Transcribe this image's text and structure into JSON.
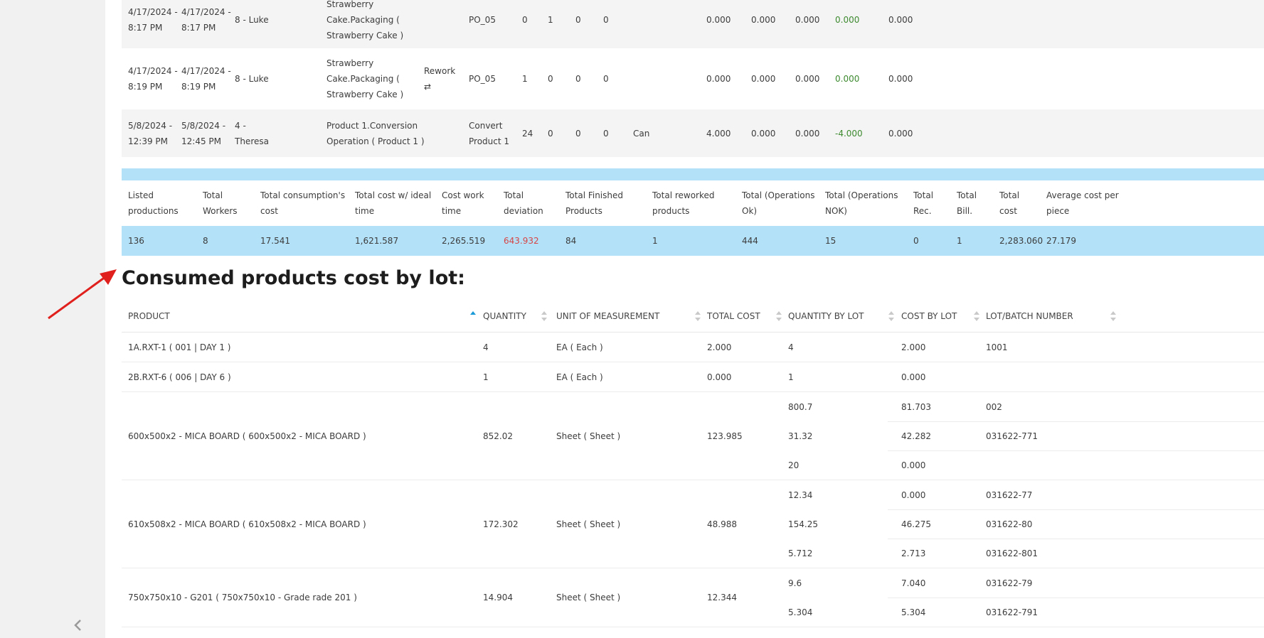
{
  "production_rows": [
    {
      "start": "4/17/2024 -\n8:17 PM",
      "end": "4/17/2024 -\n8:17 PM",
      "worker": "8 - Luke",
      "operation": "Strawberry\nCake.Packaging (\nStrawberry Cake )",
      "status": "",
      "rework_icon": "",
      "order": "PO_05",
      "n1": "0",
      "n2": "1",
      "n3": "0",
      "n4": "0",
      "extra": "",
      "c1": "0.000",
      "c2": "0.000",
      "c3": "0.000",
      "dev": "0.000",
      "c5": "0.000"
    },
    {
      "start": "4/17/2024 -\n8:19 PM",
      "end": "4/17/2024 -\n8:19 PM",
      "worker": "8 - Luke",
      "operation": "Strawberry\nCake.Packaging (\nStrawberry Cake )",
      "status": "Rework",
      "rework_icon": "⇄",
      "order": "PO_05",
      "n1": "1",
      "n2": "0",
      "n3": "0",
      "n4": "0",
      "extra": "",
      "c1": "0.000",
      "c2": "0.000",
      "c3": "0.000",
      "dev": "0.000",
      "c5": "0.000"
    },
    {
      "start": "5/8/2024 -\n12:39 PM",
      "end": "5/8/2024 -\n12:45 PM",
      "worker": "4 -\nTheresa",
      "operation": "Product 1.Conversion\nOperation ( Product 1 )",
      "status": "",
      "rework_icon": "",
      "order": "Convert\nProduct 1",
      "n1": "24",
      "n2": "0",
      "n3": "0",
      "n4": "0",
      "extra": "Can",
      "c1": "4.000",
      "c2": "0.000",
      "c3": "0.000",
      "dev": "-4.000",
      "c5": "0.000"
    }
  ],
  "summary": {
    "headers": [
      "Listed\nproductions",
      "Total\nWorkers",
      "Total consumption's\ncost",
      "Total cost w/ ideal\ntime",
      "Cost work\ntime",
      "Total\ndeviation",
      "Total Finished\nProducts",
      "Total reworked\nproducts",
      "Total (Operations\nOk)",
      "Total (Operations\nNOK)",
      "Total\nRec.",
      "Total\nBill.",
      "Total\ncost",
      "Average cost per\npiece"
    ],
    "values": [
      "136",
      "8",
      "17.541",
      "1,621.587",
      "2,265.519",
      "643.932",
      "84",
      "1",
      "444",
      "15",
      "0",
      "1",
      "2,283.060",
      "27.179"
    ]
  },
  "lot_section": {
    "title": "Consumed products cost by lot:",
    "columns": [
      "PRODUCT",
      "QUANTITY",
      "UNIT OF MEASUREMENT",
      "TOTAL COST",
      "QUANTITY BY LOT",
      "COST BY LOT",
      "LOT/BATCH NUMBER"
    ],
    "rows": [
      {
        "product": "1A.RXT-1 ( 001 | DAY 1 )",
        "quantity": "4",
        "unit": "EA ( Each )",
        "total_cost": "2.000",
        "lots": [
          {
            "qty": "4",
            "cost": "2.000",
            "lot": "1001"
          }
        ]
      },
      {
        "product": "2B.RXT-6 ( 006 | DAY 6 )",
        "quantity": "1",
        "unit": "EA ( Each )",
        "total_cost": "0.000",
        "lots": [
          {
            "qty": "1",
            "cost": "0.000",
            "lot": ""
          }
        ]
      },
      {
        "product": "600x500x2 - MICA BOARD ( 600x500x2 - MICA BOARD )",
        "quantity": "852.02",
        "unit": "Sheet ( Sheet )",
        "total_cost": "123.985",
        "lots": [
          {
            "qty": "800.7",
            "cost": "81.703",
            "lot": "002"
          },
          {
            "qty": "31.32",
            "cost": "42.282",
            "lot": "031622-771"
          },
          {
            "qty": "20",
            "cost": "0.000",
            "lot": ""
          }
        ]
      },
      {
        "product": "610x508x2 - MICA BOARD ( 610x508x2 - MICA BOARD )",
        "quantity": "172.302",
        "unit": "Sheet ( Sheet )",
        "total_cost": "48.988",
        "lots": [
          {
            "qty": "12.34",
            "cost": "0.000",
            "lot": "031622-77"
          },
          {
            "qty": "154.25",
            "cost": "46.275",
            "lot": "031622-80"
          },
          {
            "qty": "5.712",
            "cost": "2.713",
            "lot": "031622-801"
          }
        ]
      },
      {
        "product": "750x750x10 - G201 ( 750x750x10 - Grade rade 201 )",
        "quantity": "14.904",
        "unit": "Sheet ( Sheet )",
        "total_cost": "12.344",
        "lots": [
          {
            "qty": "9.6",
            "cost": "7.040",
            "lot": "031622-79"
          },
          {
            "qty": "5.304",
            "cost": "5.304",
            "lot": "031622-791"
          }
        ]
      }
    ]
  },
  "colors": {
    "accent_blue": "#b3e1f8",
    "sort_active": "#1a9ad6",
    "deviation_green": "#3d8a2f",
    "deviation_red": "#d64545",
    "annotation_arrow": "#e0201c"
  },
  "icons": {
    "collapse": "chevron-left-icon",
    "rework": "repeat-icon",
    "sort": "sort-icon"
  }
}
